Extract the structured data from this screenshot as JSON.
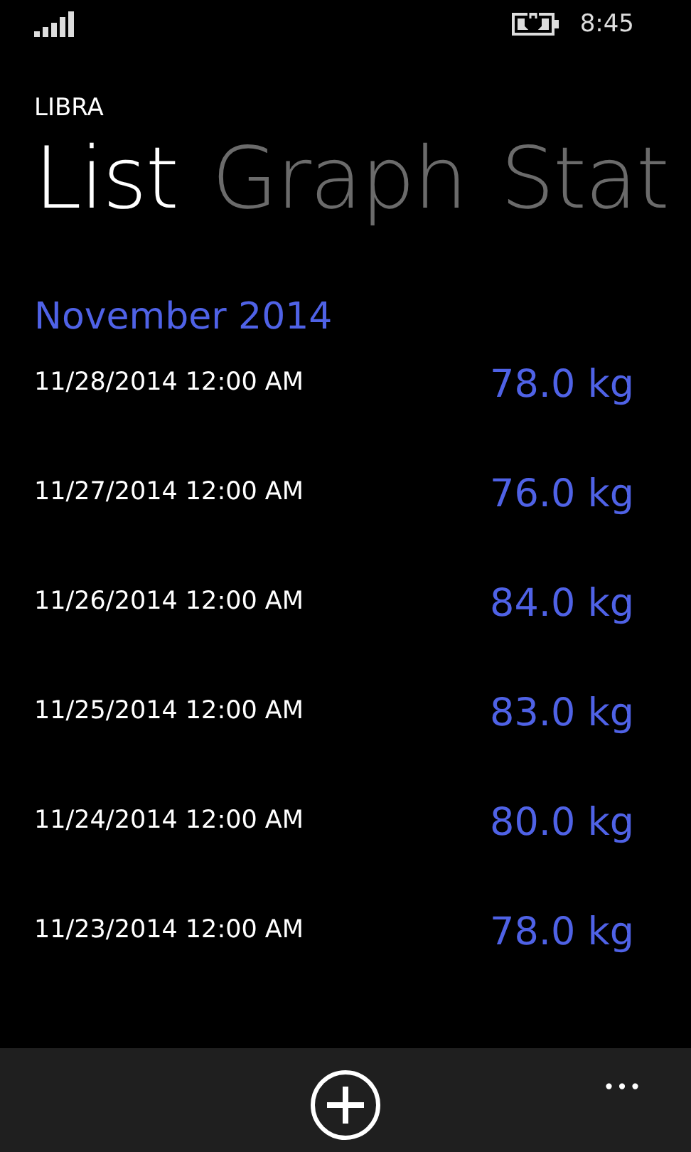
{
  "status_bar": {
    "time": "8:45"
  },
  "app_title": "LIBRA",
  "pivot": [
    {
      "label": "List",
      "selected": true
    },
    {
      "label": "Graph",
      "selected": false
    },
    {
      "label": "Stat",
      "selected": false
    }
  ],
  "group": {
    "title": "November 2014"
  },
  "entries": [
    {
      "date": "11/28/2014 12:00 AM",
      "weight": "78.0 kg"
    },
    {
      "date": "11/27/2014 12:00 AM",
      "weight": "76.0 kg"
    },
    {
      "date": "11/26/2014 12:00 AM",
      "weight": "84.0 kg"
    },
    {
      "date": "11/25/2014 12:00 AM",
      "weight": "83.0 kg"
    },
    {
      "date": "11/24/2014 12:00 AM",
      "weight": "80.0 kg"
    },
    {
      "date": "11/23/2014 12:00 AM",
      "weight": "78.0 kg"
    }
  ],
  "app_bar": {
    "buttons": [
      {
        "kind": "add"
      }
    ],
    "more": "•••"
  }
}
